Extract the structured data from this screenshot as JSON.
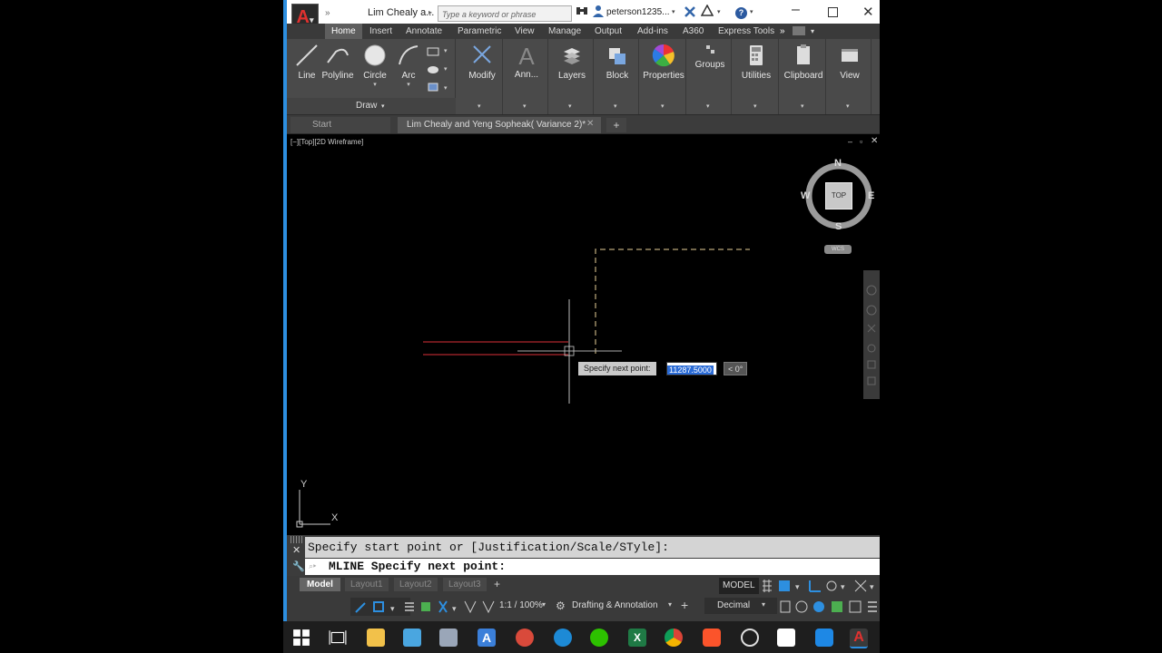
{
  "title_bar": {
    "doc_title": "Lim Chealy a...",
    "search_placeholder": "Type a keyword or phrase",
    "user": "peterson1235...",
    "help": "?"
  },
  "ribbon_tabs": [
    "Home",
    "Insert",
    "Annotate",
    "Parametric",
    "View",
    "Manage",
    "Output",
    "Add-ins",
    "A360",
    "Express Tools"
  ],
  "ribbon": {
    "draw_tools": [
      "Line",
      "Polyline",
      "Circle",
      "Arc"
    ],
    "draw_panel": "Draw",
    "modify": "Modify",
    "annotation": "Ann...",
    "layers": "Layers",
    "block": "Block",
    "properties": "Properties",
    "groups": "Groups",
    "utilities": "Utilities",
    "clipboard": "Clipboard",
    "view": "View"
  },
  "doc_tabs": {
    "start": "Start",
    "active": "Lim Chealy and Yeng Sopheak( Variance 2)*"
  },
  "viewport": {
    "label": "[−][Top][2D Wireframe]",
    "compass": {
      "n": "N",
      "s": "S",
      "e": "E",
      "w": "W",
      "top": "TOP"
    },
    "wcs": "WCS",
    "ucs_y": "Y",
    "ucs_x": "X",
    "prompt": "Specify next point:",
    "input_value": "11287.5000",
    "angle": "< 0°"
  },
  "command": {
    "history": "Specify start point or [Justification/Scale/STyle]:",
    "current": "MLINE Specify next point:"
  },
  "layout_tabs": [
    "Model",
    "Layout1",
    "Layout2",
    "Layout3"
  ],
  "status": {
    "model": "MODEL",
    "scale": "1:1 / 100%",
    "workspace": "Drafting & Annotation",
    "units": "Decimal"
  },
  "colors": {
    "accent": "#2d8fe0",
    "ribbon_bg": "#4a4a4a",
    "canvas_bg": "#000000",
    "mline_red": "#b0272c",
    "logo_red": "#e0312f"
  }
}
